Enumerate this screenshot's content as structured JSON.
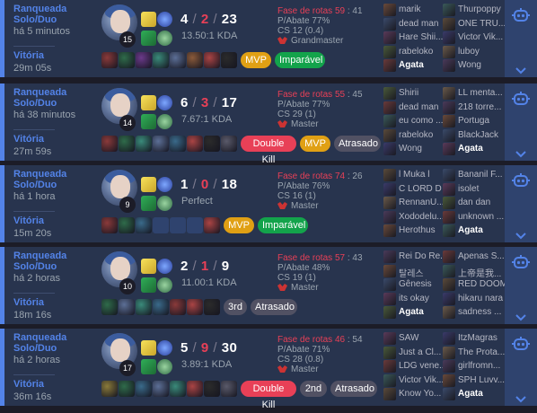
{
  "labels": {
    "lane_prefix": "Fase de rotas",
    "kp_prefix": "P/Abate",
    "cs_prefix": "CS"
  },
  "colors": {
    "win_border": "#5383e8",
    "card_bg": "#28344e",
    "deaths": "#e84057",
    "mvp": "#e0a014",
    "imparavel": "#13a34b",
    "double_kill": "#e84057",
    "neutral_badge": "#515163"
  },
  "matches": [
    {
      "queue": "Ranqueada Solo/Duo",
      "time_ago": "há 5 minutos",
      "result": "Vitória",
      "duration": "29m 05s",
      "level": "15",
      "kills": "4",
      "deaths": "2",
      "assists": "23",
      "kda_ratio": "13.50:1 KDA",
      "lane_score": "59",
      "lane_extra": "41",
      "kill_participation": "77%",
      "cs": "12 (0.4)",
      "rank": "Grandmaster",
      "badges": [
        {
          "label": "MVP",
          "kind": "mvp"
        },
        {
          "label": "Imparável",
          "kind": "imp"
        }
      ],
      "items": [
        "#8a3a3a",
        "#2f6b4a",
        "#6b3a8a",
        "#3a8a7a",
        "#5c6f96",
        "#8a5a3a",
        "#a44",
        "#2b2b2b"
      ],
      "blue": [
        {
          "name": "marik"
        },
        {
          "name": "dead man"
        },
        {
          "name": "Hare Shii..."
        },
        {
          "name": "rabeloko"
        },
        {
          "name": "Ágata",
          "me": true
        }
      ],
      "red": [
        {
          "name": "Thurpoppy"
        },
        {
          "name": "ONE TRU..."
        },
        {
          "name": "Victor Vik..."
        },
        {
          "name": "luboy"
        },
        {
          "name": "Wong"
        }
      ]
    },
    {
      "queue": "Ranqueada Solo/Duo",
      "time_ago": "há 38 minutos",
      "result": "Vitória",
      "duration": "27m 59s",
      "level": "14",
      "kills": "6",
      "deaths": "3",
      "assists": "17",
      "kda_ratio": "7.67:1 KDA",
      "lane_score": "55",
      "lane_extra": "45",
      "kill_participation": "77%",
      "cs": "29 (1)",
      "rank": "Master",
      "badges": [
        {
          "label": "Double Kill",
          "kind": "dk"
        },
        {
          "label": "MVP",
          "kind": "mvp"
        },
        {
          "label": "Atrasado",
          "kind": "gray"
        }
      ],
      "items": [
        "#8a3a3a",
        "#2f6b4a",
        "#3a8a7a",
        "#5c6f96",
        "#3a6a8a",
        "#a44",
        "#2b2b2b",
        "#5a5a6a"
      ],
      "blue": [
        {
          "name": "Shirii"
        },
        {
          "name": "dead man"
        },
        {
          "name": "eu como ..."
        },
        {
          "name": "rabeloko"
        },
        {
          "name": "Wong"
        }
      ],
      "red": [
        {
          "name": "LL menta..."
        },
        {
          "name": "218 torre..."
        },
        {
          "name": "Portuga"
        },
        {
          "name": "BlackJack"
        },
        {
          "name": "Ágata",
          "me": true
        }
      ]
    },
    {
      "queue": "Ranqueada Solo/Duo",
      "time_ago": "há 1 hora",
      "result": "Vitória",
      "duration": "15m 20s",
      "level": "9",
      "kills": "1",
      "deaths": "0",
      "assists": "18",
      "kda_ratio": "Perfect",
      "lane_score": "74",
      "lane_extra": "26",
      "kill_participation": "76%",
      "cs": "16 (1)",
      "rank": "Master",
      "badges": [
        {
          "label": "MVP",
          "kind": "mvp"
        },
        {
          "label": "Imparável",
          "kind": "imp"
        }
      ],
      "items": [
        "#8a3a3a",
        "#2f6b4a",
        "#3a6a8a",
        "",
        "",
        "",
        "#a44"
      ],
      "blue": [
        {
          "name": "l Muka l"
        },
        {
          "name": "C LORD D"
        },
        {
          "name": "RennanU..."
        },
        {
          "name": "Xododelu..."
        },
        {
          "name": "Herothus"
        }
      ],
      "red": [
        {
          "name": "Bananil F..."
        },
        {
          "name": "isolet"
        },
        {
          "name": "dan dan"
        },
        {
          "name": "unknown ..."
        },
        {
          "name": "Ágata",
          "me": true
        }
      ]
    },
    {
      "queue": "Ranqueada Solo/Duo",
      "time_ago": "há 2 horas",
      "result": "Vitória",
      "duration": "18m 16s",
      "level": "10",
      "kills": "2",
      "deaths": "1",
      "assists": "9",
      "kda_ratio": "11.00:1 KDA",
      "lane_score": "57",
      "lane_extra": "43",
      "kill_participation": "48%",
      "cs": "19 (1)",
      "rank": "Master",
      "badges": [
        {
          "label": "3rd",
          "kind": "gray"
        },
        {
          "label": "Atrasado",
          "kind": "gray"
        }
      ],
      "items": [
        "#2f6b4a",
        "#5c6f96",
        "#3a8a7a",
        "#3a6a8a",
        "#8a3a3a",
        "#a44",
        "#2b2b2b"
      ],
      "blue": [
        {
          "name": "Rei Do Re..."
        },
        {
          "name": "탈레스"
        },
        {
          "name": "Gênesis"
        },
        {
          "name": "its okay"
        },
        {
          "name": "Ágata",
          "me": true
        }
      ],
      "red": [
        {
          "name": "Apenas S..."
        },
        {
          "name": "上帝是我..."
        },
        {
          "name": "RED DOOM"
        },
        {
          "name": "hikaru nara"
        },
        {
          "name": "sadness ..."
        }
      ]
    },
    {
      "queue": "Ranqueada Solo/Duo",
      "time_ago": "há 2 horas",
      "result": "Vitória",
      "duration": "36m 16s",
      "level": "17",
      "kills": "5",
      "deaths": "9",
      "assists": "30",
      "kda_ratio": "3.89:1 KDA",
      "lane_score": "46",
      "lane_extra": "54",
      "kill_participation": "71%",
      "cs": "28 (0.8)",
      "rank": "Master",
      "badges": [
        {
          "label": "Double Kill",
          "kind": "dk"
        },
        {
          "label": "2nd",
          "kind": "gray"
        },
        {
          "label": "Atrasado",
          "kind": "gray"
        }
      ],
      "items": [
        "#8a7a3a",
        "#2f6b4a",
        "#3a6a8a",
        "#5c6f96",
        "#3a8a7a",
        "#a44",
        "#2b2b2b",
        "#5a5a6a"
      ],
      "blue": [
        {
          "name": "SAW"
        },
        {
          "name": "Just a Cl..."
        },
        {
          "name": "LDG vene..."
        },
        {
          "name": "Victor Vik..."
        },
        {
          "name": "Know Yo..."
        }
      ],
      "red": [
        {
          "name": "ItzMagras"
        },
        {
          "name": "The Prota..."
        },
        {
          "name": "girlfromn..."
        },
        {
          "name": "SPH Luvv..."
        },
        {
          "name": "Ágata",
          "me": true
        }
      ]
    }
  ]
}
